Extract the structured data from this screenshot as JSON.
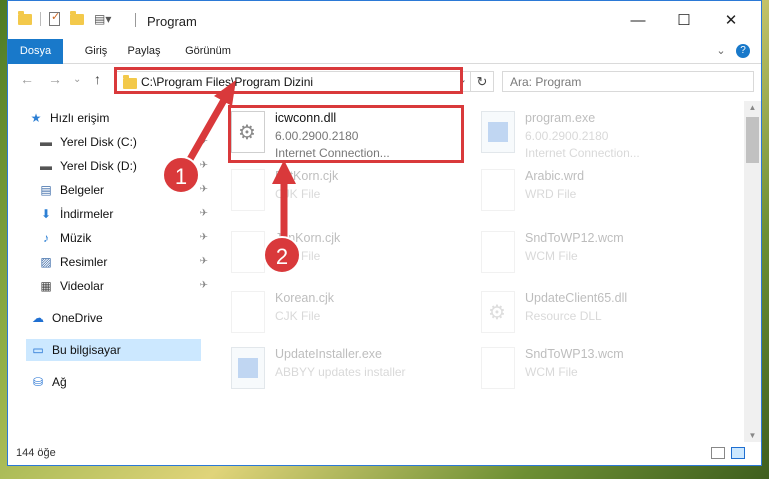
{
  "window": {
    "title": "Program",
    "controls": {
      "minimize": "—",
      "maximize": "☐",
      "close": "✕"
    }
  },
  "ribbon": {
    "tabs": [
      "Dosya",
      "Giriş",
      "Paylaş",
      "Görünüm"
    ],
    "expand_icon": "⌄",
    "help_icon": "?"
  },
  "nav": {
    "back": "←",
    "forward": "→",
    "recent": "⌄",
    "up": "↑",
    "address": "C:\\Program Files\\Program Dizini",
    "refresh": "↻",
    "search_placeholder": "Ara: Program"
  },
  "sidebar": {
    "items": [
      {
        "label": "Hızlı erişim",
        "icon": "★"
      },
      {
        "label": "Yerel Disk (C:)",
        "icon": "▬"
      },
      {
        "label": "Yerel Disk (D:)",
        "icon": "▬"
      },
      {
        "label": "Belgeler",
        "icon": "▤"
      },
      {
        "label": "İndirmeler",
        "icon": "⬇"
      },
      {
        "label": "Müzik",
        "icon": "♪"
      },
      {
        "label": "Resimler",
        "icon": "▨"
      },
      {
        "label": "Videolar",
        "icon": "▦"
      },
      {
        "label": "OneDrive",
        "icon": "☁"
      },
      {
        "label": "Bu bilgisayar",
        "icon": "▭"
      },
      {
        "label": "Ağ",
        "icon": "⛁"
      }
    ],
    "pin": "📌"
  },
  "files": [
    {
      "name": "icwconn.dll",
      "line2": "6.00.2900.2180",
      "line3": "Internet Connection...",
      "icon": "gear"
    },
    {
      "name": "program.exe",
      "line2": "6.00.2900.2180",
      "line3": "Internet Connection...",
      "icon": "exe"
    },
    {
      "name": "EstKorn.cjk",
      "line2": "CJK File",
      "line3": "",
      "icon": "blank"
    },
    {
      "name": "Arabic.wrd",
      "line2": "WRD File",
      "line3": "",
      "icon": "blank"
    },
    {
      "name": "JpnKorn.cjk",
      "line2": "CJK File",
      "line3": "",
      "icon": "blank"
    },
    {
      "name": "SndToWP12.wcm",
      "line2": "WCM File",
      "line3": "",
      "icon": "blank"
    },
    {
      "name": "Korean.cjk",
      "line2": "CJK File",
      "line3": "",
      "icon": "blank"
    },
    {
      "name": "UpdateClient65.dll",
      "line2": "Resource DLL",
      "line3": "",
      "icon": "gear"
    },
    {
      "name": "UpdateInstaller.exe",
      "line2": "ABBYY updates installer",
      "line3": "",
      "icon": "exe"
    },
    {
      "name": "SndToWP13.wcm",
      "line2": "WCM File",
      "line3": "",
      "icon": "blank"
    }
  ],
  "status": {
    "count": "144 öğe"
  },
  "annotations": {
    "step1": "1",
    "step2": "2",
    "color": "#d9393b"
  }
}
